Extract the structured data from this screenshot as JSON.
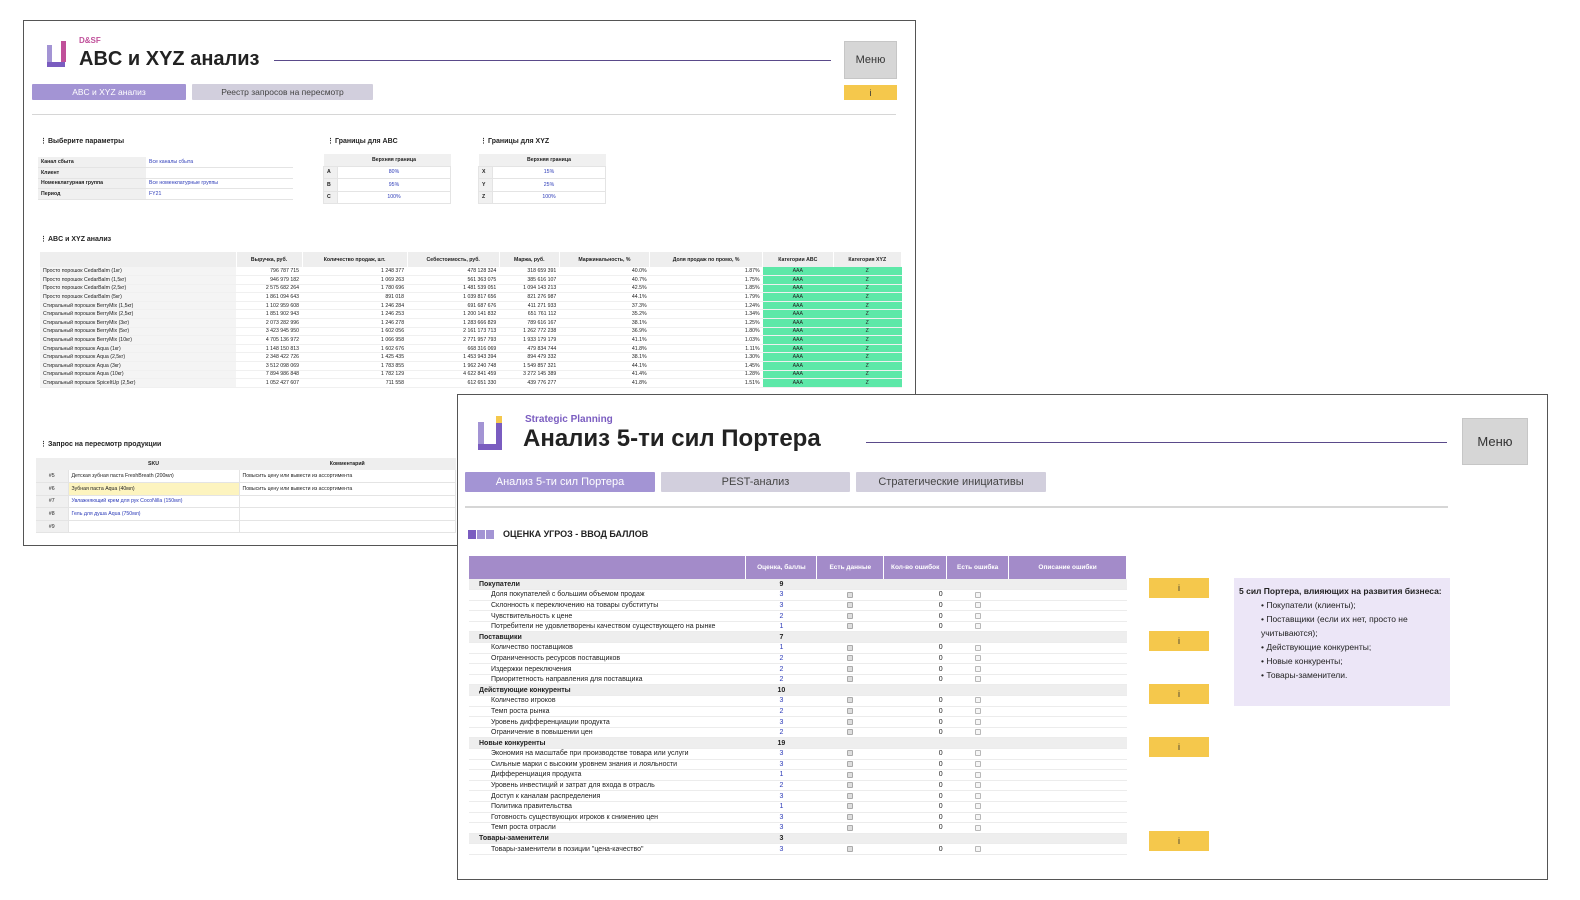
{
  "win1": {
    "brand": "D&SF",
    "title": "ABC и XYZ анализ",
    "menu": "Меню",
    "tabs": [
      "ABC и XYZ анализ",
      "Реестр запросов на пересмотр"
    ],
    "info": "i",
    "params": {
      "heading": "Выберите параметры",
      "rows": [
        {
          "label": "Канал сбыта",
          "value": "Все каналы сбыта"
        },
        {
          "label": "Клиент",
          "value": ""
        },
        {
          "label": "Номенклатурная группа",
          "value": "Все номенклатурные группы"
        },
        {
          "label": "Период",
          "value": "FY21"
        }
      ]
    },
    "abc_bounds": {
      "heading": "Границы для ABC",
      "col": "Верхняя граница",
      "rows": [
        {
          "k": "A",
          "v": "80%"
        },
        {
          "k": "B",
          "v": "95%"
        },
        {
          "k": "C",
          "v": "100%"
        }
      ]
    },
    "xyz_bounds": {
      "heading": "Границы для XYZ",
      "col": "Верхняя граница",
      "rows": [
        {
          "k": "X",
          "v": "15%"
        },
        {
          "k": "Y",
          "v": "25%"
        },
        {
          "k": "Z",
          "v": "100%"
        }
      ]
    },
    "analysis": {
      "heading": "ABC и XYZ анализ",
      "columns": [
        "",
        "Выручка, руб.",
        "Количество продаж, шт.",
        "Себестоимость, руб.",
        "Маржа, руб.",
        "Маржинальность, %",
        "Доля продаж по промо, %",
        "Категории ABC",
        "Категория XYZ"
      ],
      "rows": [
        [
          "Просто порошок CedarBalm (1кг)",
          "796 787 715",
          "1 248 377",
          "478 128 324",
          "318 659 391",
          "40.0%",
          "1.87%",
          "AAA",
          "Z"
        ],
        [
          "Просто порошок CedarBalm (1,5кг)",
          "946 979 182",
          "1 069 263",
          "561 363 075",
          "385 616 107",
          "40.7%",
          "1.75%",
          "AAA",
          "Z"
        ],
        [
          "Просто порошок CedarBalm (2,5кг)",
          "2 575 682 264",
          "1 780 696",
          "1 481 539 051",
          "1 094 143 213",
          "42.5%",
          "1.85%",
          "AAA",
          "Z"
        ],
        [
          "Просто порошок CedarBalm (5кг)",
          "1 861 094 643",
          "891 018",
          "1 039 817 656",
          "821 276 987",
          "44.1%",
          "1.79%",
          "AAA",
          "Z"
        ],
        [
          "Стиральный порошок BerryMix (1,5кг)",
          "1 102 959 608",
          "1 246 284",
          "691 687 676",
          "411 271 933",
          "37.3%",
          "1.24%",
          "AAA",
          "Z"
        ],
        [
          "Стиральный порошок BerryMix (2,5кг)",
          "1 851 902 943",
          "1 246 253",
          "1 200 141 832",
          "651 761 112",
          "35.2%",
          "1.34%",
          "AAA",
          "Z"
        ],
        [
          "Стиральный порошок BerryMix (3кг)",
          "2 073 282 996",
          "1 246 278",
          "1 283 666 829",
          "789 616 167",
          "38.1%",
          "1.25%",
          "AAA",
          "Z"
        ],
        [
          "Стиральный порошок BerryMix (5кг)",
          "3 423 945 950",
          "1 602 056",
          "2 161 173 713",
          "1 262 772 238",
          "36.9%",
          "1.80%",
          "AAA",
          "Z"
        ],
        [
          "Стиральный порошок BerryMix (10кг)",
          "4 705 136 972",
          "1 066 958",
          "2 771 957 793",
          "1 933 179 179",
          "41.1%",
          "1.03%",
          "AAA",
          "Z"
        ],
        [
          "Стиральный порошок Aqua (1кг)",
          "1 148 150 813",
          "1 602 676",
          "668 316 069",
          "479 834 744",
          "41.8%",
          "1.11%",
          "AAA",
          "Z"
        ],
        [
          "Стиральный порошок Aqua (2,5кг)",
          "2 348 422 726",
          "1 425 435",
          "1 453 943 394",
          "894 479 332",
          "38.1%",
          "1.30%",
          "AAA",
          "Z"
        ],
        [
          "Стиральный порошок Aqua (3кг)",
          "3 512 098 069",
          "1 783 855",
          "1 962 240 748",
          "1 549 857 321",
          "44.1%",
          "1.45%",
          "AAA",
          "Z"
        ],
        [
          "Стиральный порошок Aqua (10кг)",
          "7 894 986 848",
          "1 782 129",
          "4 622 841 459",
          "3 272 145 389",
          "41.4%",
          "1.28%",
          "AAA",
          "Z"
        ],
        [
          "Стиральный порошок SpiceItUp (2,5кг)",
          "1 052 427 607",
          "711 558",
          "612 651 330",
          "439 776 277",
          "41.8%",
          "1.51%",
          "AAA",
          "Z"
        ]
      ]
    },
    "request": {
      "heading": "Запрос на пересмотр продукции",
      "columns": [
        "",
        "SKU",
        "Комментарий"
      ],
      "rows": [
        {
          "no": "#5",
          "sku": "Детская зубная паста FreshBreath (200мл)",
          "comment": "Повысить цену или вывести из ассортимента"
        },
        {
          "no": "#6",
          "sku": "Зубная паста Aqua (40мл)",
          "comment": "Повысить цену или вывести из ассортимента"
        },
        {
          "no": "#7",
          "sku": "Увлажняющий крем для рук CocoNilla (150мл)",
          "comment": ""
        },
        {
          "no": "#8",
          "sku": "Гель для душа Aqua (750мл)",
          "comment": ""
        },
        {
          "no": "#9",
          "sku": "",
          "comment": ""
        }
      ]
    }
  },
  "win2": {
    "subtitle": "Strategic Planning",
    "title": "Анализ 5-ти сил Портера",
    "menu": "Меню",
    "tabs": [
      "Анализ 5-ти сил Портера",
      "PEST-анализ",
      "Стратегические инициативы"
    ],
    "section": "ОЦЕНКА УГРОЗ - ВВОД БАЛЛОВ",
    "columns": [
      "",
      "Оценка, баллы",
      "Есть данные",
      "Кол-во ошибок",
      "Есть ошибка",
      "Описание ошибки"
    ],
    "groups": [
      {
        "name": "Покупатели",
        "score": "9",
        "items": [
          {
            "name": "Доля покупателей с большим объемом продаж",
            "score": "3",
            "errors": "0"
          },
          {
            "name": "Склонность к переключению на товары субституты",
            "score": "3",
            "errors": "0"
          },
          {
            "name": "Чувствительность к цене",
            "score": "2",
            "errors": "0"
          },
          {
            "name": "Потребители не удовлетворены качеством существующего на рынке",
            "score": "1",
            "errors": "0"
          }
        ]
      },
      {
        "name": "Поставщики",
        "score": "7",
        "items": [
          {
            "name": "Количество поставщиков",
            "score": "1",
            "errors": "0"
          },
          {
            "name": "Ограниченность ресурсов поставщиков",
            "score": "2",
            "errors": "0"
          },
          {
            "name": "Издержки переключения",
            "score": "2",
            "errors": "0"
          },
          {
            "name": "Приоритетность направления для поставщика",
            "score": "2",
            "errors": "0"
          }
        ]
      },
      {
        "name": "Действующие конкуренты",
        "score": "10",
        "items": [
          {
            "name": "Количество игроков",
            "score": "3",
            "errors": "0"
          },
          {
            "name": "Темп роста рынка",
            "score": "2",
            "errors": "0"
          },
          {
            "name": "Уровень дифференциации продукта",
            "score": "3",
            "errors": "0"
          },
          {
            "name": "Ограничение в повышении цен",
            "score": "2",
            "errors": "0"
          }
        ]
      },
      {
        "name": "Новые конкуренты",
        "score": "19",
        "items": [
          {
            "name": "Экономия на масштабе при производстве товара или услуги",
            "score": "3",
            "errors": "0"
          },
          {
            "name": "Сильные марки с высоким уровнем знания и лояльности",
            "score": "3",
            "errors": "0"
          },
          {
            "name": "Дифференциация продукта",
            "score": "1",
            "errors": "0"
          },
          {
            "name": "Уровень инвестиций и затрат для входа в отрасль",
            "score": "2",
            "errors": "0"
          },
          {
            "name": "Доступ к каналам распределения",
            "score": "3",
            "errors": "0"
          },
          {
            "name": "Политика правительства",
            "score": "1",
            "errors": "0"
          },
          {
            "name": "Готовность существующих игроков к снижению цен",
            "score": "3",
            "errors": "0"
          },
          {
            "name": "Темп роста отрасли",
            "score": "3",
            "errors": "0"
          }
        ]
      },
      {
        "name": "Товары-заменители",
        "score": "3",
        "items": [
          {
            "name": "Товары-заменители в позиции \"цена-качество\"",
            "score": "3",
            "errors": "0"
          }
        ]
      }
    ],
    "info": "i",
    "infobox": {
      "heading": "5 сил Портера, влияющих на развития бизнеса:",
      "items": [
        "Покупатели (клиенты);",
        "Поставщики (если их нет, просто не учитываются);",
        "Действующие конкуренты;",
        "Новые конкуренты;",
        "Товары-заменители."
      ]
    }
  },
  "colors": {
    "accent": "#a394d4",
    "info": "#f5c84c",
    "green": "#5de8a8",
    "header": "#a38bc9"
  }
}
